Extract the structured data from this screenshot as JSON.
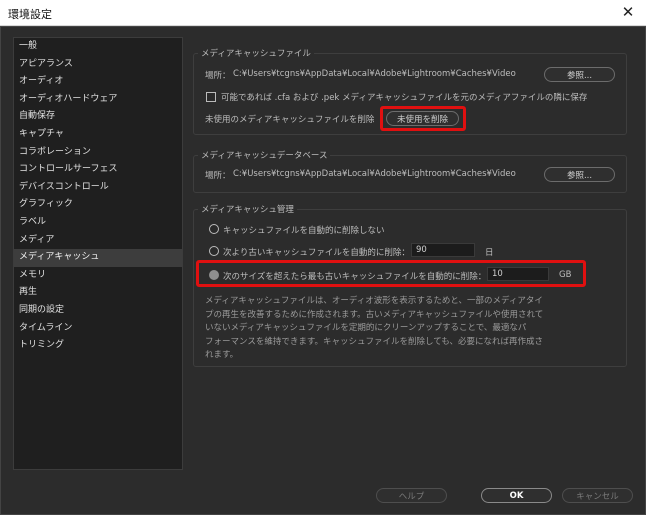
{
  "window": {
    "title": "環境設定",
    "close_glyph": "✕"
  },
  "sidebar": {
    "items": [
      "一般",
      "アピアランス",
      "オーディオ",
      "オーディオハードウェア",
      "自動保存",
      "キャプチャ",
      "コラボレーション",
      "コントロールサーフェス",
      "デバイスコントロール",
      "グラフィック",
      "ラベル",
      "メディア",
      "メディアキャッシュ",
      "メモリ",
      "再生",
      "同期の設定",
      "タイムライン",
      "トリミング"
    ],
    "selected_index": 12
  },
  "media_cache_files": {
    "title": "メディアキャッシュファイル",
    "location_label": "場所：",
    "location_path": "C:¥Users¥tcgns¥AppData¥Local¥Adobe¥Lightroom¥Caches¥Video",
    "browse_label": "参照...",
    "save_next_label": "可能であれば .cfa および .pek メディアキャッシュファイルを元のメディアファイルの隣に保存",
    "save_next_checked": false,
    "delete_unused_label": "未使用のメディアキャッシュファイルを削除",
    "delete_unused_button": "未使用を削除"
  },
  "media_cache_db": {
    "title": "メディアキャッシュデータベース",
    "location_label": "場所：",
    "location_path": "C:¥Users¥tcgns¥AppData¥Local¥Adobe¥Lightroom¥Caches¥Video",
    "browse_label": "参照..."
  },
  "media_cache_mgmt": {
    "title": "メディアキャッシュ管理",
    "opt_no_delete": "キャッシュファイルを自動的に削除しない",
    "opt_older_than": "次より古いキャッシュファイルを自動的に削除：",
    "older_than_value": "90",
    "older_than_unit": "日",
    "opt_exceeds_size": "次のサイズを超えたら最も古いキャッシュファイルを自動的に削除：",
    "size_value": "10",
    "size_unit": "GB",
    "selected_option": "exceeds_size",
    "description_lines": [
      "メディアキャッシュファイルは、オーディオ波形を表示するためと、一部のメディアタイ",
      "プの再生を改善するために作成されます。古いメディアキャッシュファイルや使用されて",
      "いないメディアキャッシュファイルを定期的にクリーンアップすることで、最適なパ",
      "フォーマンスを維持できます。キャッシュファイルを削除しても、必要になれば再作成さ",
      "れます。"
    ]
  },
  "footer": {
    "help": "ヘルプ",
    "ok": "OK",
    "cancel": "キャンセル"
  },
  "annotations": {
    "highlight_color": "#e01010"
  }
}
